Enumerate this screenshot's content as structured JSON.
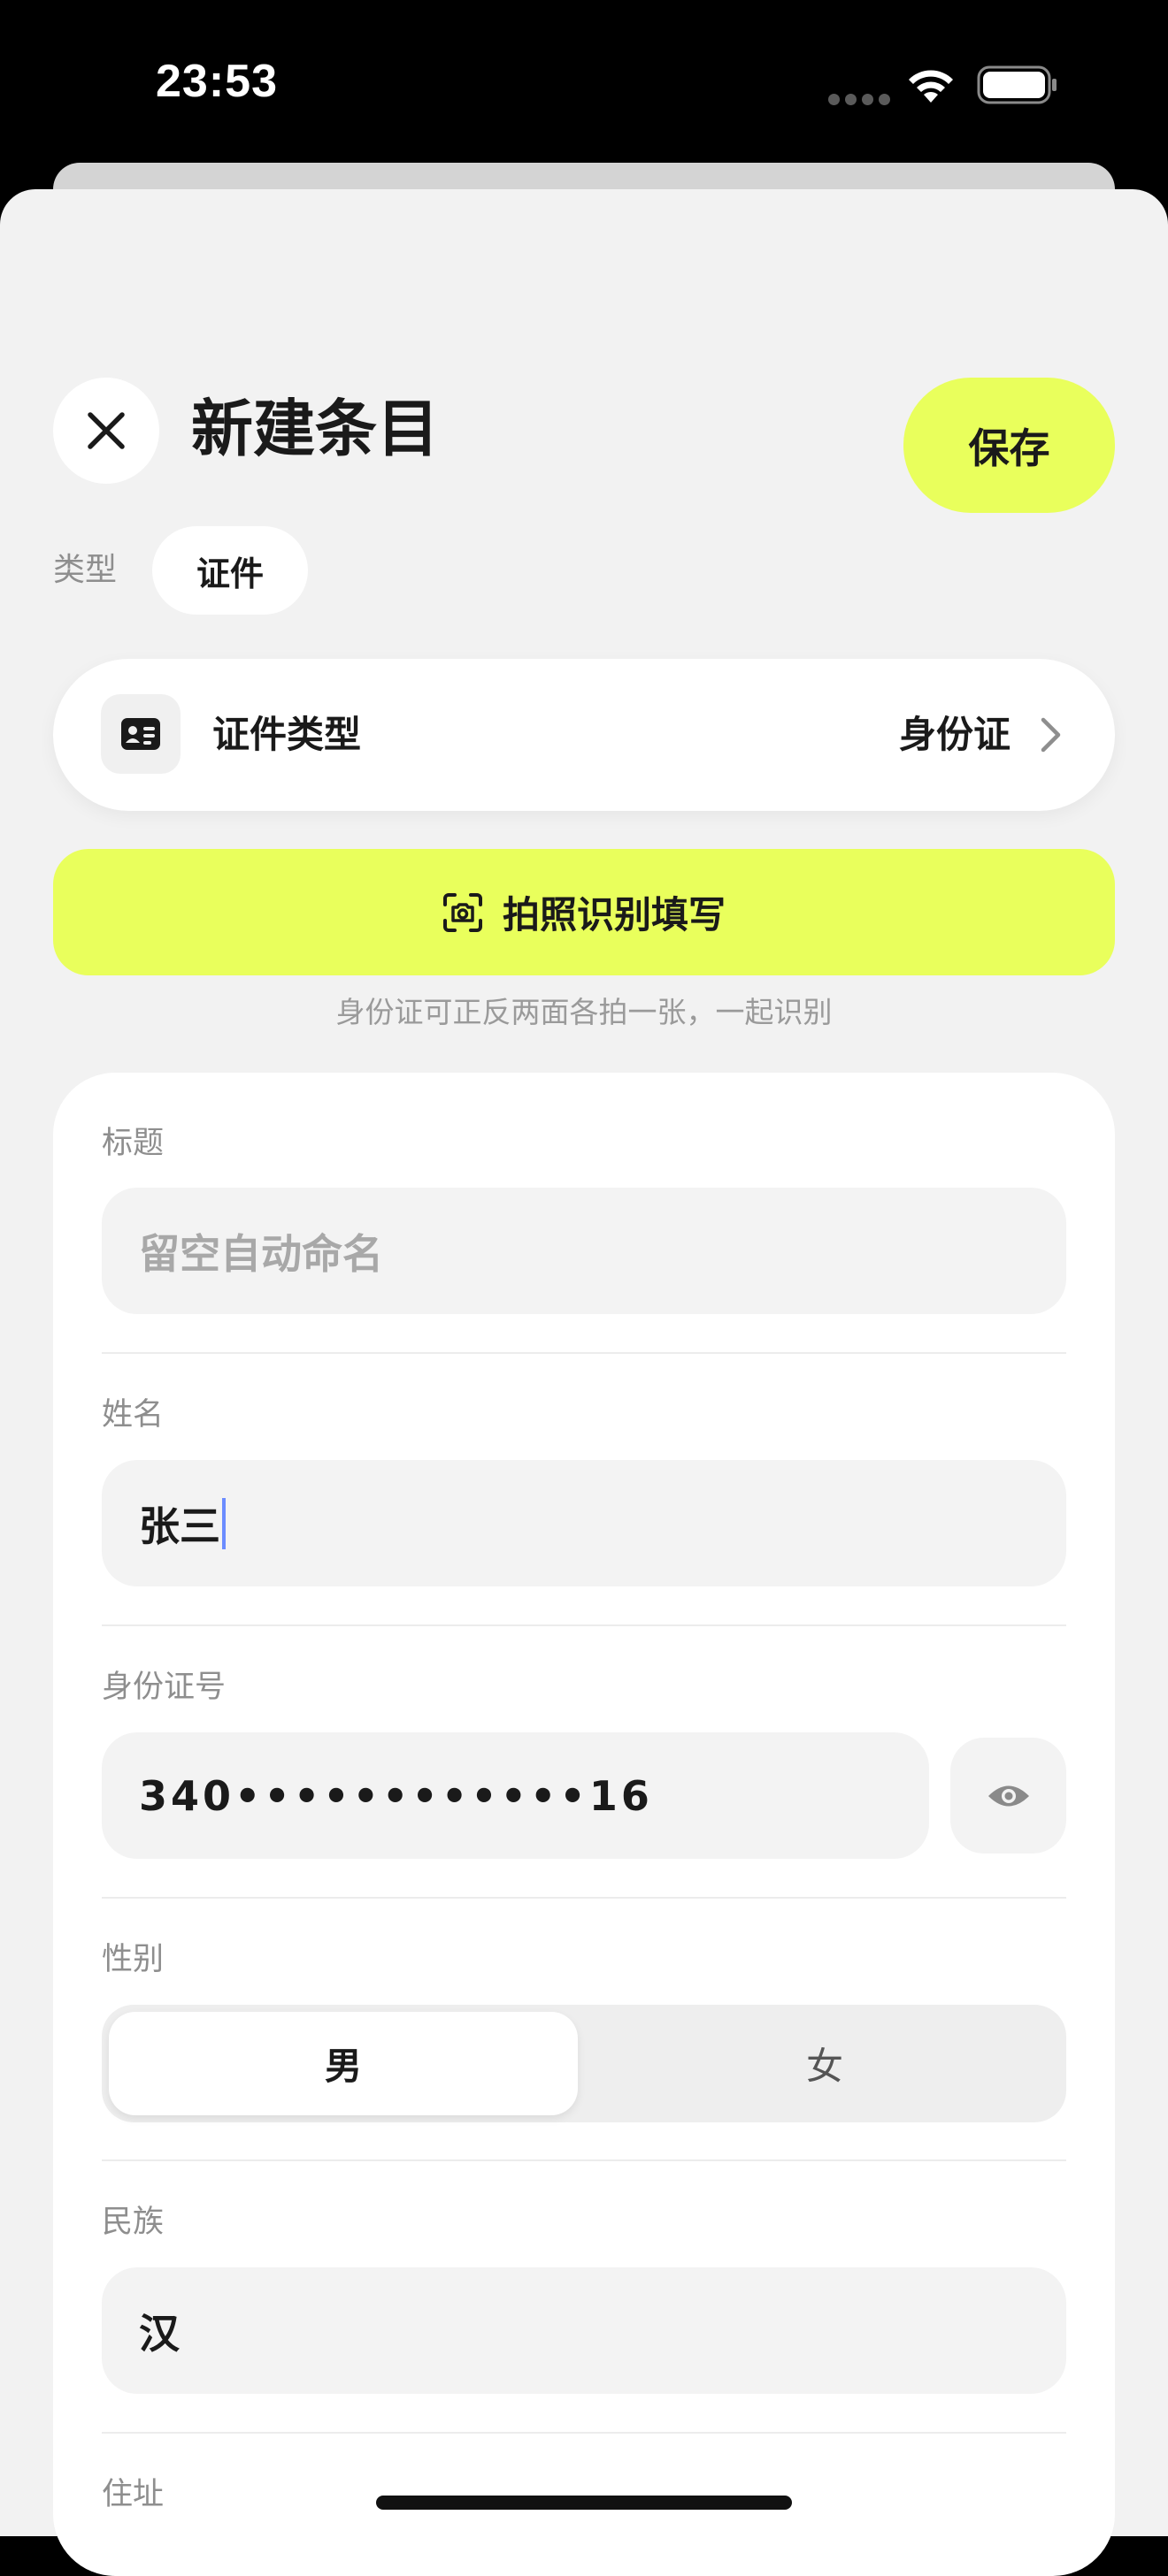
{
  "status_bar": {
    "time": "23:53"
  },
  "header": {
    "title": "新建条目",
    "save_label": "保存"
  },
  "type": {
    "label": "类型",
    "value": "证件"
  },
  "doc_type": {
    "label": "证件类型",
    "value": "身份证"
  },
  "scan": {
    "label": "拍照识别填写",
    "hint": "身份证可正反两面各拍一张，一起识别"
  },
  "form": {
    "title": {
      "label": "标题",
      "placeholder": "留空自动命名"
    },
    "name": {
      "label": "姓名",
      "value": "张三"
    },
    "id_number": {
      "label": "身份证号",
      "value": "340••••••••••••16"
    },
    "gender": {
      "label": "性别",
      "options": [
        "男",
        "女"
      ],
      "selected": "男"
    },
    "ethnicity": {
      "label": "民族",
      "value": "汉"
    },
    "address": {
      "label": "住址"
    }
  },
  "colors": {
    "accent": "#e9ff5c",
    "background": "#f2f2f2",
    "card": "#ffffff",
    "input": "#f3f3f3",
    "cursor": "#6b8cff"
  },
  "icons": {
    "close": "close-icon",
    "id_card": "id-card-icon",
    "chevron": "chevron-right-icon",
    "scan": "camera-scan-icon",
    "eye": "eye-icon"
  }
}
